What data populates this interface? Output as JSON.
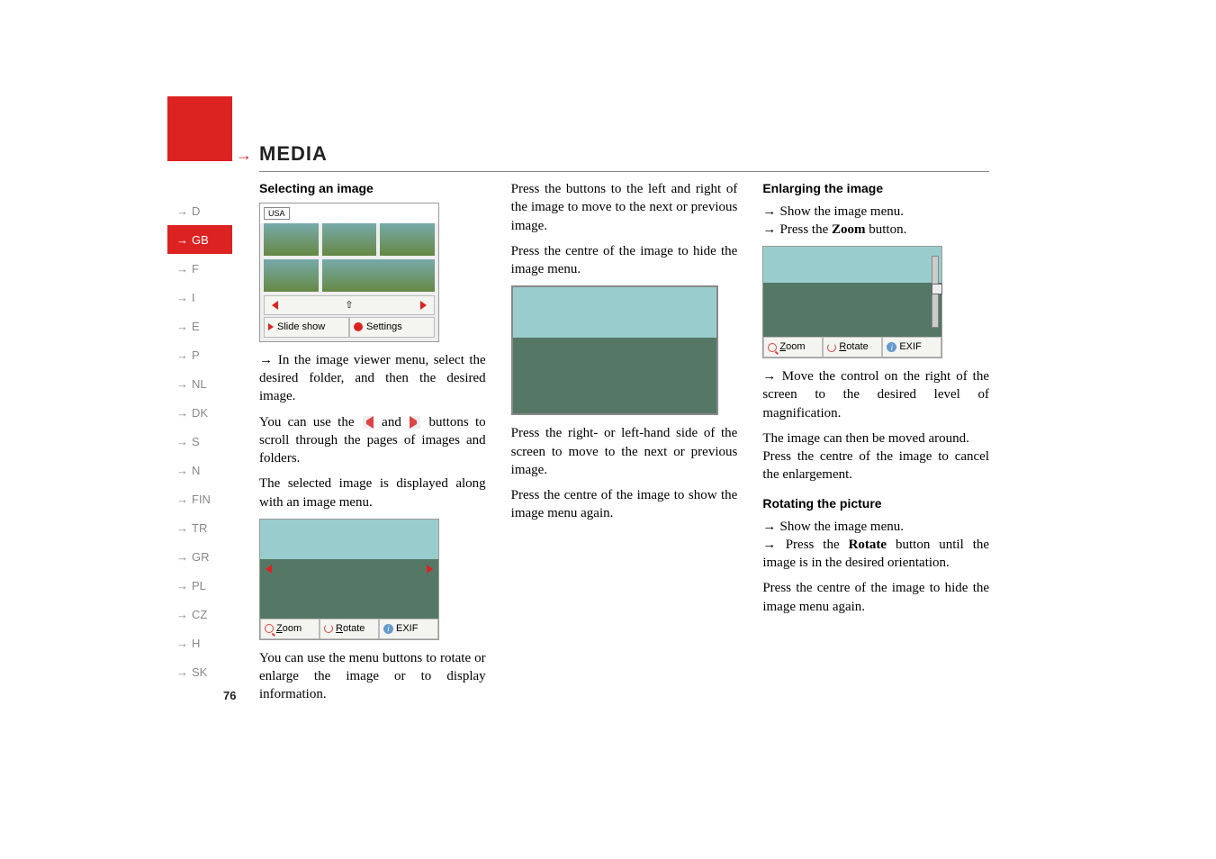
{
  "sidebar": {
    "items": [
      {
        "code": "D"
      },
      {
        "code": "GB"
      },
      {
        "code": "F"
      },
      {
        "code": "I"
      },
      {
        "code": "E"
      },
      {
        "code": "P"
      },
      {
        "code": "NL"
      },
      {
        "code": "DK"
      },
      {
        "code": "S"
      },
      {
        "code": "N"
      },
      {
        "code": "FIN"
      },
      {
        "code": "TR"
      },
      {
        "code": "GR"
      },
      {
        "code": "PL"
      },
      {
        "code": "CZ"
      },
      {
        "code": "H"
      },
      {
        "code": "SK"
      }
    ],
    "active_index": 1
  },
  "header": {
    "arrows": "→→→",
    "title": "MEDIA"
  },
  "page_number": "76",
  "col1": {
    "heading": "Selecting an image",
    "fig1": {
      "usa": "USA",
      "slide_show": "Slide show",
      "settings": "Settings"
    },
    "bullet1": "In the image viewer menu, select the desired folder, and then the desired image.",
    "para1_a": "You can use the ",
    "para1_b": " and ",
    "para1_c": " buttons to scroll through the pages of images and folders.",
    "para2": "The selected image is displayed along with an image menu.",
    "fig2": {
      "zoom": "Zoom",
      "rotate": "Rotate",
      "exif": "EXIF"
    },
    "para3": "You can use the menu buttons to rotate or enlarge the image or to display information."
  },
  "col2": {
    "para1": "Press the buttons to the left and right of the image to move to the next or previous image.",
    "para2": "Press the centre of the image to hide the image menu.",
    "para3": "Press the right- or left-hand side of the screen to move to the next or previous image.",
    "para4": "Press the centre of the image to show the image menu again."
  },
  "col3": {
    "heading1": "Enlarging the image",
    "bullet1": "Show the image menu.",
    "bullet2_a": "Press the ",
    "bullet2_bold": "Zoom",
    "bullet2_b": " button.",
    "fig": {
      "zoom": "Zoom",
      "rotate": "Rotate",
      "exif": "EXIF"
    },
    "bullet3": "Move the control on the right of the screen to the desired level of magnification.",
    "para1": "The image can then be moved around.",
    "para2": "Press the centre of the image to cancel the enlargement.",
    "heading2": "Rotating the picture",
    "bullet4": "Show the image menu.",
    "bullet5_a": "Press the ",
    "bullet5_bold": "Rotate",
    "bullet5_b": " button until the image is in the desired orientation.",
    "para3": "Press the centre of the image to hide the image menu again."
  }
}
